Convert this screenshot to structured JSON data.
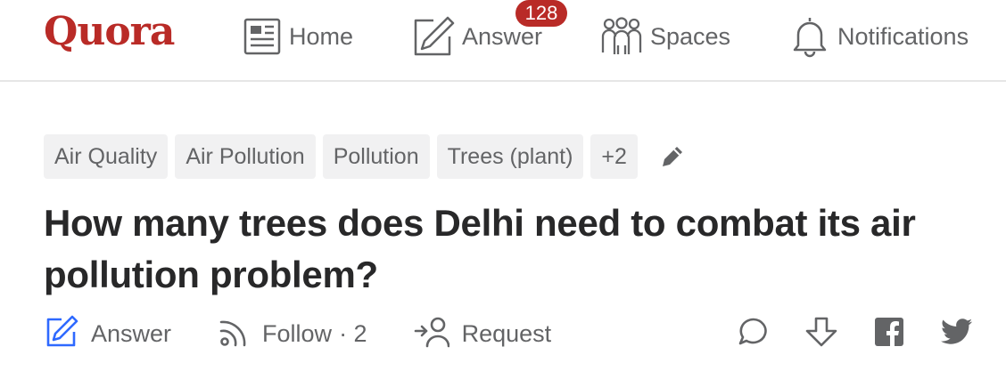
{
  "header": {
    "logo": "Quora",
    "nav": {
      "home": "Home",
      "answer": "Answer",
      "answer_badge": "128",
      "spaces": "Spaces",
      "notifications": "Notifications"
    }
  },
  "question": {
    "topics": [
      "Air Quality",
      "Air Pollution",
      "Pollution",
      "Trees (plant)",
      "+2"
    ],
    "title": "How many trees does Delhi need to combat its air pollution problem?",
    "actions": {
      "answer": "Answer",
      "follow": "Follow",
      "follow_count": "· 2",
      "request": "Request"
    }
  },
  "colors": {
    "brand": "#b92b27",
    "answer_icon": "#2e69ff",
    "text_muted": "#636466"
  },
  "icons": [
    "home-icon",
    "answer-pen-icon",
    "spaces-icon",
    "bell-icon",
    "pencil-icon",
    "answer-icon",
    "follow-icon",
    "request-icon",
    "comment-icon",
    "downvote-icon",
    "facebook-icon",
    "twitter-icon"
  ]
}
